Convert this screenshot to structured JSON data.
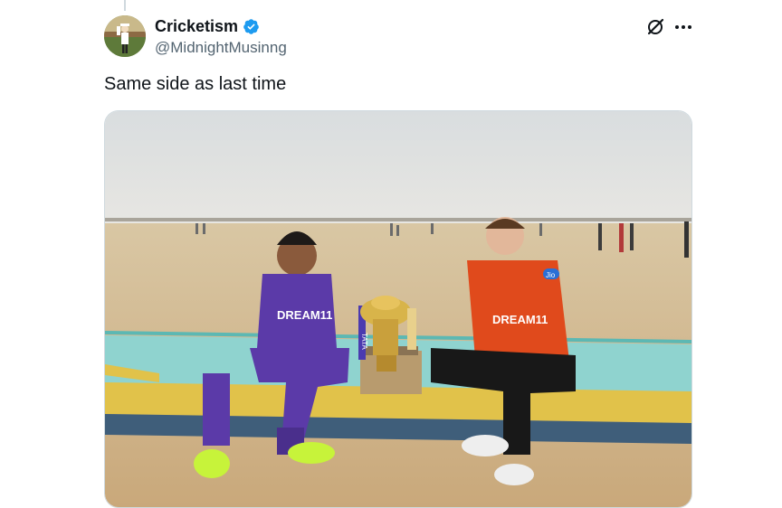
{
  "tweet": {
    "author": {
      "display_name": "Cricketism",
      "handle": "@MidnightMusinng",
      "verified_icon": "verified-badge-icon",
      "verified_color": "#1d9bf0"
    },
    "text": "Same side as last time",
    "actions": {
      "grok_icon": "grok-icon",
      "more_icon": "more-icon"
    },
    "media": {
      "jersey_left": "DREAM11",
      "jersey_right": "DREAM11",
      "sponsor_right": "Jio",
      "trophy_ribbon": "TATA"
    }
  }
}
